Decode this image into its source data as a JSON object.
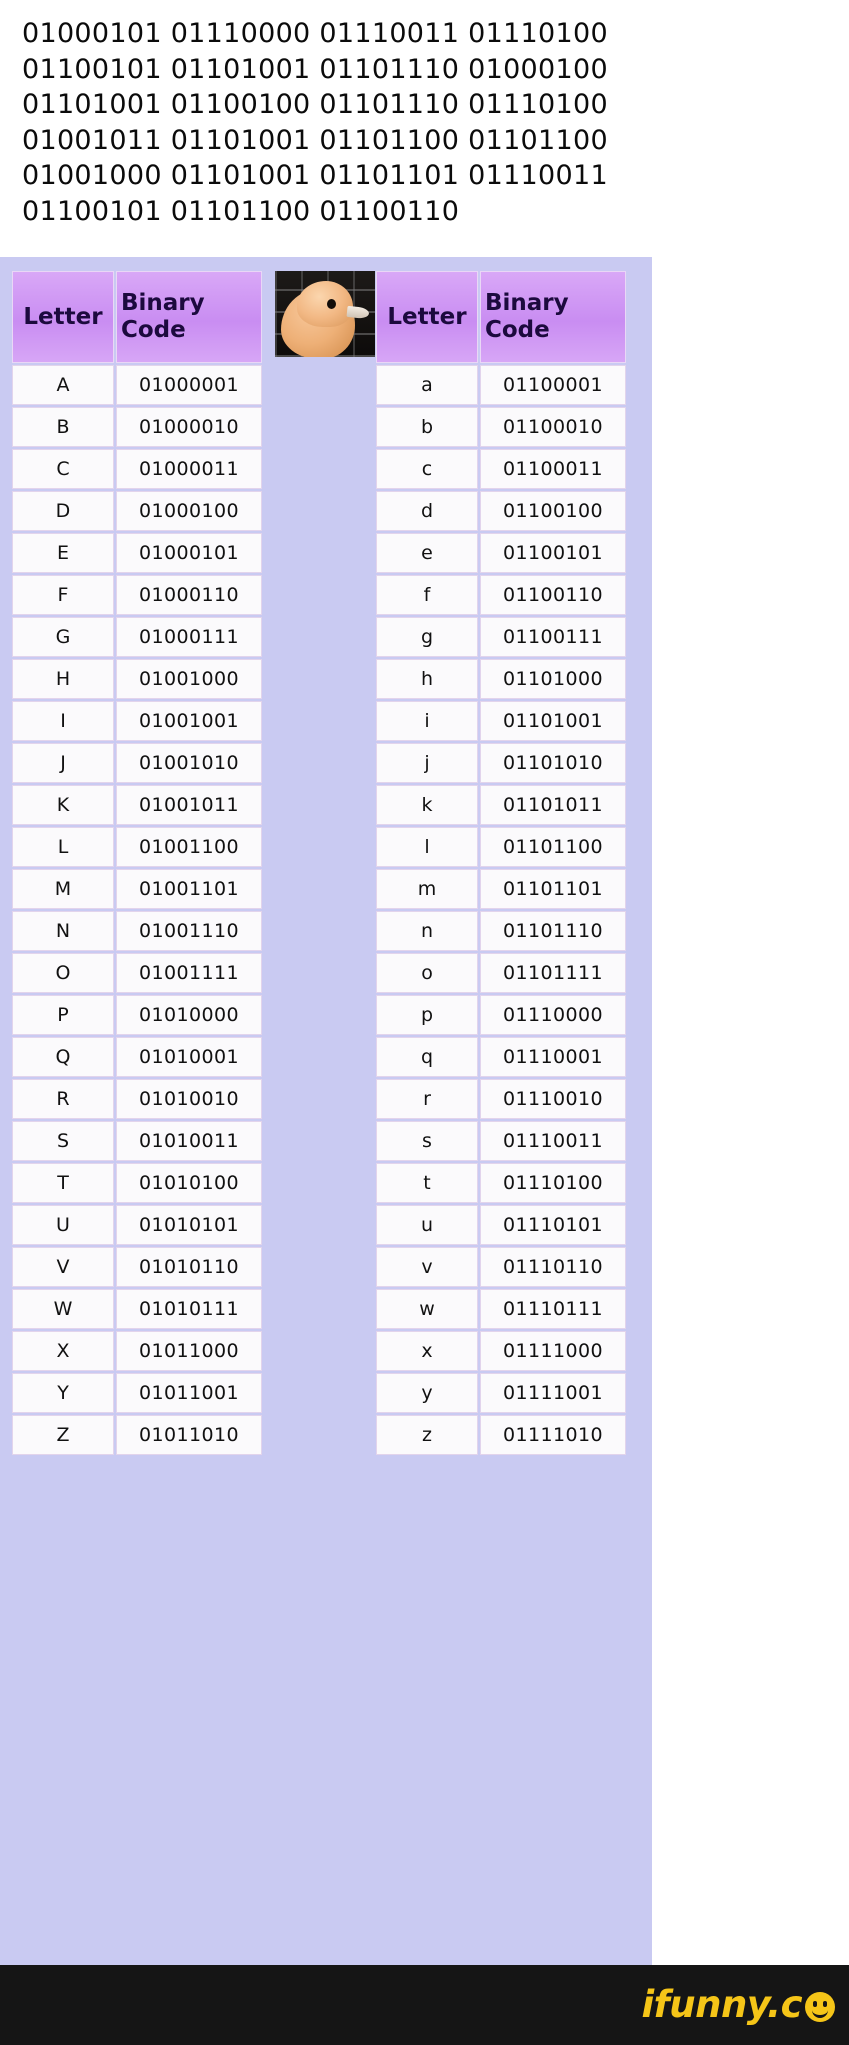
{
  "binary_message": {
    "lines": [
      "01000101 01110000 01110011 01110100",
      "01100101 01101001 01101110 01000100",
      "01101001 01100100 01101110 01110100",
      "01001011 01101001 01101100 01101100",
      "01001000 01101001 01101101 01110011",
      "01100101 01101100 01100110"
    ]
  },
  "table": {
    "headers": {
      "letter": "Letter",
      "binary_code": "Binary\nCode",
      "binary_code_line1": "Binary",
      "binary_code_line2": "Code"
    },
    "uppercase_rows": [
      {
        "letter": "A",
        "code": "01000001"
      },
      {
        "letter": "B",
        "code": "01000010"
      },
      {
        "letter": "C",
        "code": "01000011"
      },
      {
        "letter": "D",
        "code": "01000100"
      },
      {
        "letter": "E",
        "code": "01000101"
      },
      {
        "letter": "F",
        "code": "01000110"
      },
      {
        "letter": "G",
        "code": "01000111"
      },
      {
        "letter": "H",
        "code": "01001000"
      },
      {
        "letter": "I",
        "code": "01001001"
      },
      {
        "letter": "J",
        "code": "01001010"
      },
      {
        "letter": "K",
        "code": "01001011"
      },
      {
        "letter": "L",
        "code": "01001100"
      },
      {
        "letter": "M",
        "code": "01001101"
      },
      {
        "letter": "N",
        "code": "01001110"
      },
      {
        "letter": "O",
        "code": "01001111"
      },
      {
        "letter": "P",
        "code": "01010000"
      },
      {
        "letter": "Q",
        "code": "01010001"
      },
      {
        "letter": "R",
        "code": "01010010"
      },
      {
        "letter": "S",
        "code": "01010011"
      },
      {
        "letter": "T",
        "code": "01010100"
      },
      {
        "letter": "U",
        "code": "01010101"
      },
      {
        "letter": "V",
        "code": "01010110"
      },
      {
        "letter": "W",
        "code": "01010111"
      },
      {
        "letter": "X",
        "code": "01011000"
      },
      {
        "letter": "Y",
        "code": "01011001"
      },
      {
        "letter": "Z",
        "code": "01011010"
      }
    ],
    "lowercase_rows": [
      {
        "letter": "a",
        "code": "01100001"
      },
      {
        "letter": "b",
        "code": "01100010"
      },
      {
        "letter": "c",
        "code": "01100011"
      },
      {
        "letter": "d",
        "code": "01100100"
      },
      {
        "letter": "e",
        "code": "01100101"
      },
      {
        "letter": "f",
        "code": "01100110"
      },
      {
        "letter": "g",
        "code": "01100111"
      },
      {
        "letter": "h",
        "code": "01101000"
      },
      {
        "letter": "i",
        "code": "01101001"
      },
      {
        "letter": "j",
        "code": "01101010"
      },
      {
        "letter": "k",
        "code": "01101011"
      },
      {
        "letter": "l",
        "code": "01101100"
      },
      {
        "letter": "m",
        "code": "01101101"
      },
      {
        "letter": "n",
        "code": "01101110"
      },
      {
        "letter": "o",
        "code": "01101111"
      },
      {
        "letter": "p",
        "code": "01110000"
      },
      {
        "letter": "q",
        "code": "01110001"
      },
      {
        "letter": "r",
        "code": "01110010"
      },
      {
        "letter": "s",
        "code": "01110011"
      },
      {
        "letter": "t",
        "code": "01110100"
      },
      {
        "letter": "u",
        "code": "01110101"
      },
      {
        "letter": "v",
        "code": "01110110"
      },
      {
        "letter": "w",
        "code": "01110111"
      },
      {
        "letter": "x",
        "code": "01111000"
      },
      {
        "letter": "y",
        "code": "01111001"
      },
      {
        "letter": "z",
        "code": "01111010"
      }
    ]
  },
  "watermark": {
    "text": "ifunny.c",
    "icon": "smiley-face-icon"
  },
  "colors": {
    "panel_background": "#c9caf2",
    "header_purple": "#c98df2",
    "header_text": "#1c0a3e",
    "cell_background": "#fbfafc",
    "cell_border": "#e2d4ec",
    "watermark_yellow": "#f5c518",
    "watermark_bar": "#151515"
  }
}
